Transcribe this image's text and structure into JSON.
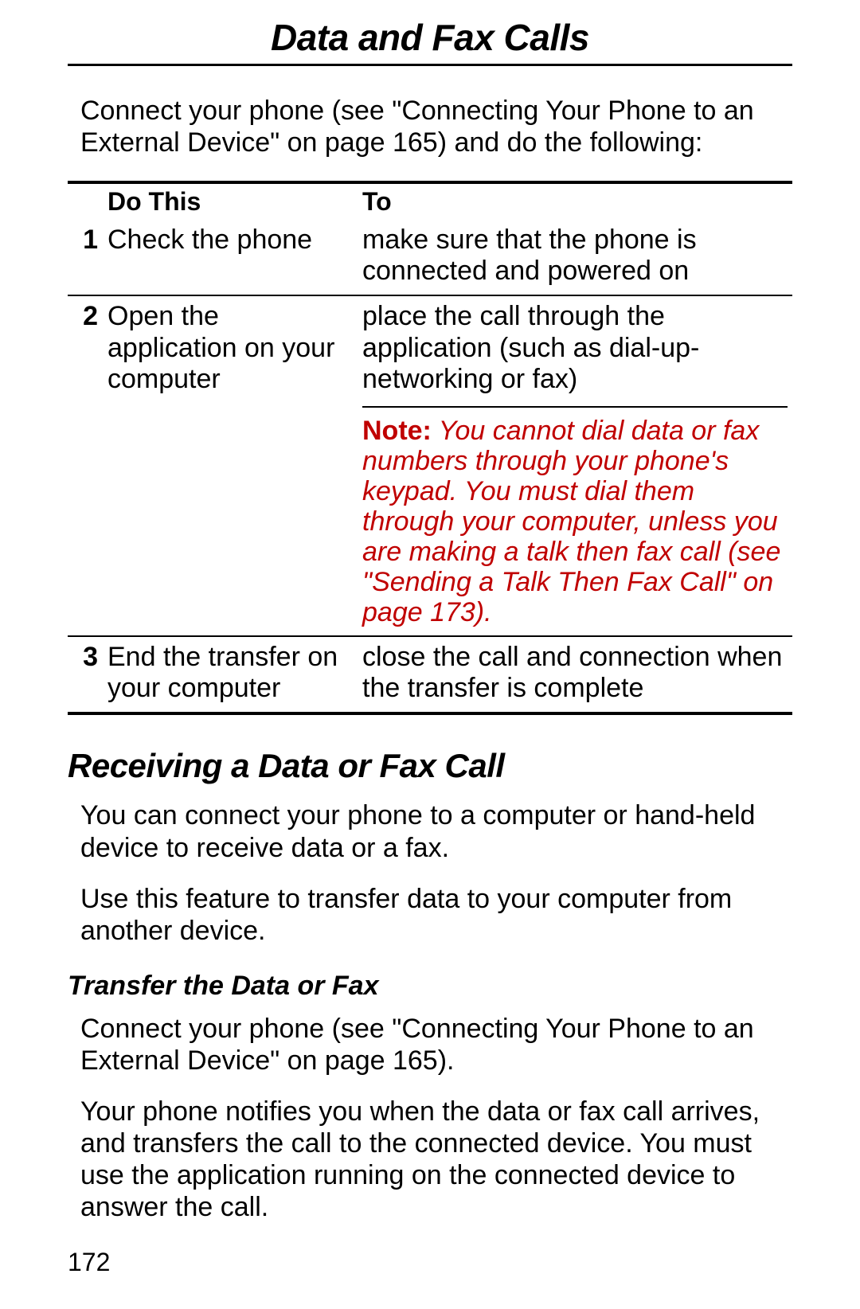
{
  "header": "Data and Fax Calls",
  "intro": "Connect your phone (see \"Connecting Your Phone to an External Device\" on page 165) and do the following:",
  "table": {
    "headers": {
      "num": "",
      "do": "Do This",
      "to": "To"
    },
    "rows": [
      {
        "num": "1",
        "do": "Check the phone",
        "to": "make sure that the phone is connected and powered on"
      },
      {
        "num": "2",
        "do": "Open the application on your computer",
        "to": "place the call through the application (such as dial-up-networking or fax)",
        "note_label": "Note:",
        "note": " You cannot dial data or fax numbers through your phone's keypad. You must dial them through your computer, unless you are making a talk then fax call (see \"Sending a Talk Then Fax Call\" on page 173)."
      },
      {
        "num": "3",
        "do": "End the transfer on your computer",
        "to": "close the call and connection when the transfer is complete"
      }
    ]
  },
  "section2": {
    "title": "Receiving a Data or Fax Call",
    "p1": "You can connect your phone to a computer or hand-held device to receive data or a fax.",
    "p2": "Use this feature to transfer data to your computer from another device."
  },
  "section3": {
    "title": "Transfer the Data or Fax",
    "p1": "Connect your phone (see \"Connecting Your Phone to an External Device\" on page 165).",
    "p2": "Your phone notifies you when the data or fax call arrives, and transfers the call to the connected device. You must use the application running on the connected device to answer the call."
  },
  "page_number": "172"
}
